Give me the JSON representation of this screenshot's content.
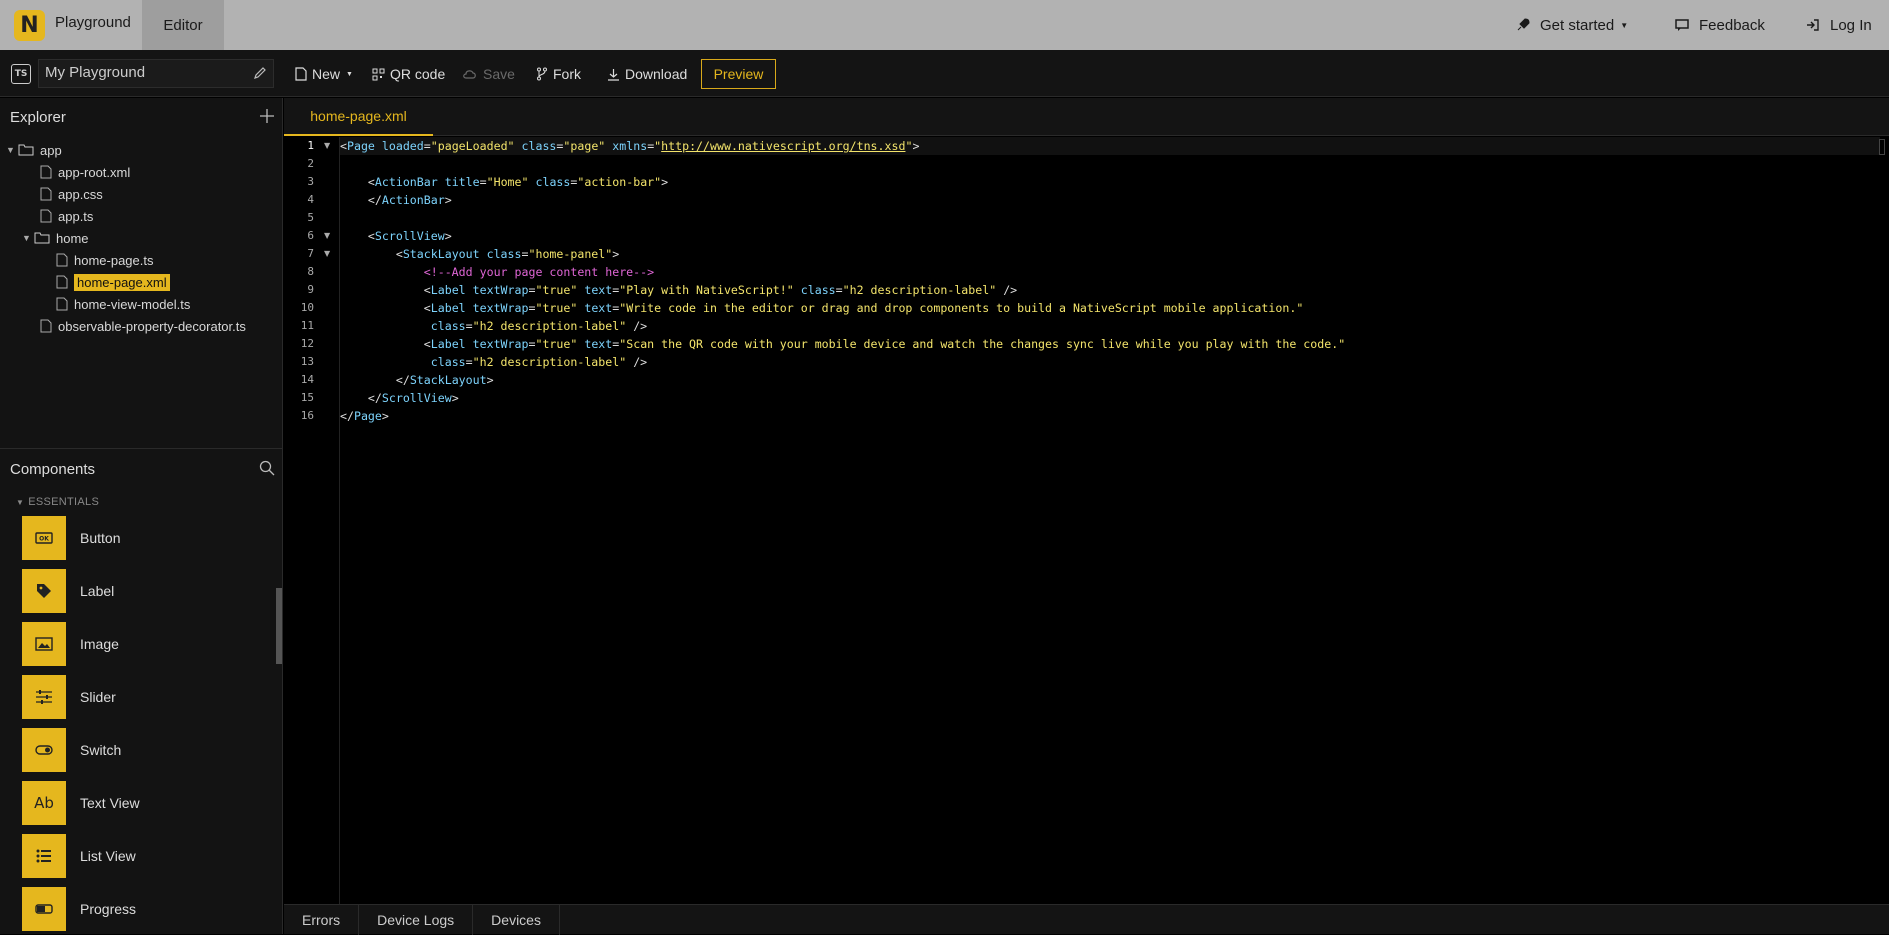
{
  "topnav": {
    "brand": "Playground",
    "editor_tab": "Editor",
    "get_started": "Get started",
    "feedback": "Feedback",
    "login": "Log In"
  },
  "toolbar": {
    "playground_name": "My Playground",
    "new_label": "New",
    "qr_label": "QR code",
    "save_label": "Save",
    "fork_label": "Fork",
    "download_label": "Download",
    "preview_label": "Preview"
  },
  "explorer": {
    "title": "Explorer",
    "items": [
      {
        "label": "app",
        "type": "folder"
      },
      {
        "label": "app-root.xml",
        "type": "file"
      },
      {
        "label": "app.css",
        "type": "file"
      },
      {
        "label": "app.ts",
        "type": "file"
      },
      {
        "label": "home",
        "type": "folder"
      },
      {
        "label": "home-page.ts",
        "type": "file"
      },
      {
        "label": "home-page.xml",
        "type": "file",
        "selected": true
      },
      {
        "label": "home-view-model.ts",
        "type": "file"
      },
      {
        "label": "observable-property-decorator.ts",
        "type": "file"
      }
    ]
  },
  "components": {
    "title": "Components",
    "section": "ESSENTIALS",
    "items": [
      {
        "label": "Button",
        "icon": "ok-button-icon"
      },
      {
        "label": "Label",
        "icon": "tag-icon"
      },
      {
        "label": "Image",
        "icon": "image-icon"
      },
      {
        "label": "Slider",
        "icon": "sliders-icon"
      },
      {
        "label": "Switch",
        "icon": "toggle-icon"
      },
      {
        "label": "Text View",
        "icon": "text-ab-icon"
      },
      {
        "label": "List View",
        "icon": "list-icon"
      },
      {
        "label": "Progress",
        "icon": "progress-icon"
      }
    ]
  },
  "editor": {
    "tab_label": "home-page.xml",
    "line_numbers": [
      "1",
      "2",
      "3",
      "4",
      "5",
      "6",
      "7",
      "8",
      "9",
      "10",
      "11",
      "12",
      "13",
      "14",
      "15",
      "16"
    ]
  },
  "bottom_tabs": [
    "Errors",
    "Device Logs",
    "Devices"
  ],
  "colors": {
    "accent": "#e5b71e",
    "nav_bg": "#b2b2b2"
  }
}
